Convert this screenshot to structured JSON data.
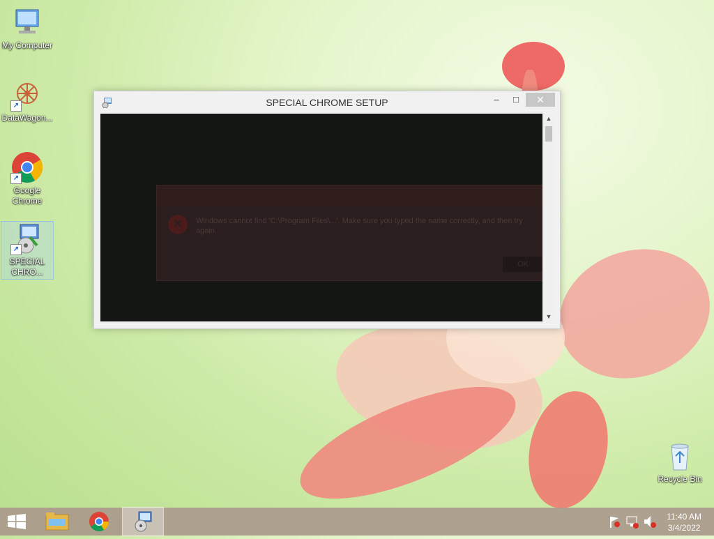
{
  "desktop_icons": [
    {
      "label": "My Computer",
      "icon": "computer-icon"
    },
    {
      "label": "DataWagon...",
      "icon": "datawagon-icon"
    },
    {
      "label": "Google Chrome",
      "icon": "chrome-icon"
    },
    {
      "label": "SPECIAL CHRO...",
      "icon": "setup-icon"
    },
    {
      "label": "Recycle Bin",
      "icon": "recycle-bin-icon"
    }
  ],
  "window": {
    "title": "SPECIAL CHROME SETUP",
    "minimize": "–",
    "maximize": "□",
    "close": "✕"
  },
  "ghost_dialog": {
    "message": "Windows cannot find 'C:\\Program Files\\...'. Make sure you typed the name correctly, and then try again.",
    "ok": "OK"
  },
  "taskbar": {
    "items": [
      {
        "name": "start",
        "icon": "windows-logo-icon"
      },
      {
        "name": "file-explorer",
        "icon": "folder-icon"
      },
      {
        "name": "chrome",
        "icon": "chrome-icon"
      },
      {
        "name": "special-chrome-setup",
        "icon": "setup-icon",
        "active": true
      }
    ],
    "clock_time": "11:40 AM",
    "clock_date": "3/4/2022"
  },
  "colors": {
    "accent": "#1d6fd1",
    "taskbar": "#aa968c",
    "window_content": "#141613"
  }
}
